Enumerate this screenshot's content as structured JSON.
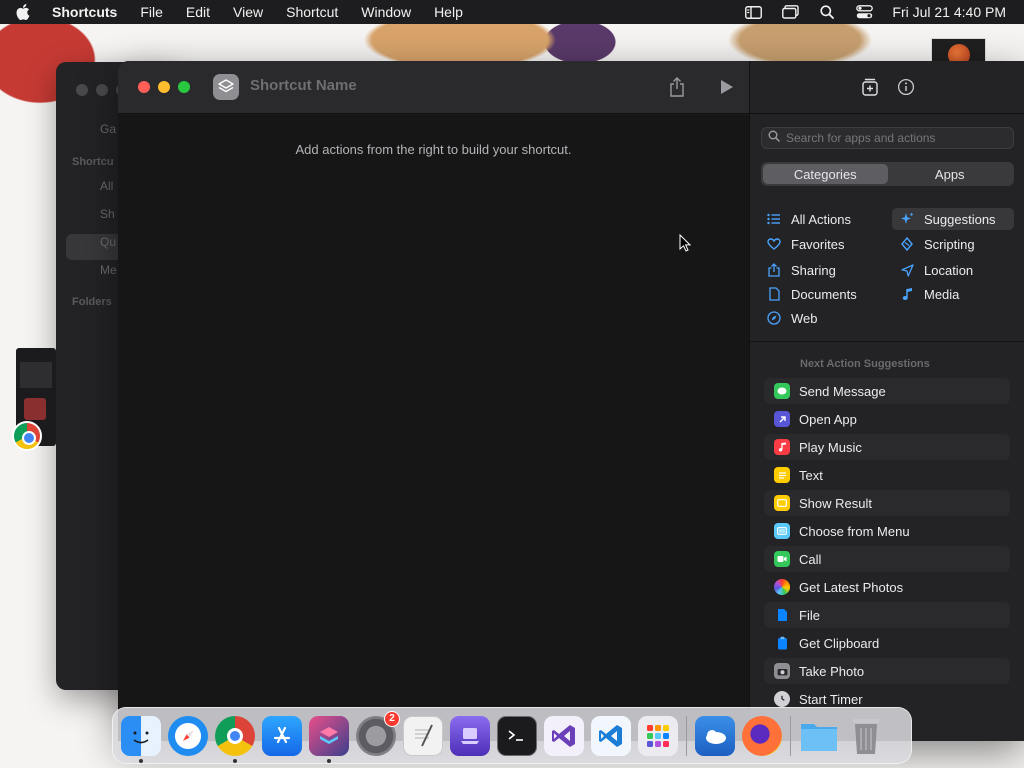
{
  "menubar": {
    "apple_icon": "apple-logo-icon",
    "app_name": "Shortcuts",
    "items": [
      "File",
      "Edit",
      "View",
      "Shortcut",
      "Window",
      "Help"
    ],
    "status_icons": [
      "sidebar-icon",
      "window-switch-icon",
      "search-icon",
      "control-center-icon"
    ],
    "clock": "Fri Jul 21  4:40 PM"
  },
  "library_window": {
    "sidebar_texts": [
      "Ga",
      "Shortcu",
      "All",
      "Sh",
      "Qu",
      "Me",
      "Folders"
    ]
  },
  "editor": {
    "shortcut_name": "Shortcut Name",
    "canvas_hint": "Add actions from the right to build your shortcut.",
    "share_icon": "share-icon",
    "run_icon": "play-icon"
  },
  "panel": {
    "search_placeholder": "Search for apps and actions",
    "segments": [
      "Categories",
      "Apps"
    ],
    "categories": [
      {
        "label": "All Actions",
        "icon": "list-icon",
        "color": "#4aa3ff"
      },
      {
        "label": "Suggestions",
        "icon": "sparkle-icon",
        "color": "#4aa3ff"
      },
      {
        "label": "Favorites",
        "icon": "heart-icon",
        "color": "#4aa3ff"
      },
      {
        "label": "Scripting",
        "icon": "scripting-icon",
        "color": "#4aa3ff"
      },
      {
        "label": "Sharing",
        "icon": "share-icon",
        "color": "#4aa3ff"
      },
      {
        "label": "Location",
        "icon": "location-arrow-icon",
        "color": "#4aa3ff"
      },
      {
        "label": "Documents",
        "icon": "document-icon",
        "color": "#4aa3ff"
      },
      {
        "label": "Media",
        "icon": "music-note-icon",
        "color": "#4aa3ff"
      },
      {
        "label": "Web",
        "icon": "compass-icon",
        "color": "#4aa3ff"
      }
    ],
    "suggestions_title": "Next Action Suggestions",
    "suggestions": [
      {
        "label": "Send Message",
        "icon": "messages-icon",
        "color": "#34c759"
      },
      {
        "label": "Open App",
        "icon": "open-app-icon",
        "color": "#5856d6"
      },
      {
        "label": "Play Music",
        "icon": "music-icon",
        "color": "#fc3c44"
      },
      {
        "label": "Text",
        "icon": "text-icon",
        "color": "#ffcc00"
      },
      {
        "label": "Show Result",
        "icon": "show-result-icon",
        "color": "#ffcc00"
      },
      {
        "label": "Choose from Menu",
        "icon": "menu-icon",
        "color": "#5ac8fa"
      },
      {
        "label": "Call",
        "icon": "phone-icon",
        "color": "#34c759"
      },
      {
        "label": "Get Latest Photos",
        "icon": "photos-icon",
        "color": "#ff9500"
      },
      {
        "label": "File",
        "icon": "file-icon",
        "color": "#0a84ff"
      },
      {
        "label": "Get Clipboard",
        "icon": "clipboard-icon",
        "color": "#0a84ff"
      },
      {
        "label": "Take Photo",
        "icon": "camera-icon",
        "color": "#8e8e93"
      },
      {
        "label": "Start Timer",
        "icon": "timer-icon",
        "color": "#d1d1d6"
      }
    ]
  },
  "dock": {
    "apps": [
      {
        "name": "finder-icon",
        "color": "#2b8ef5",
        "running": true
      },
      {
        "name": "safari-icon",
        "color": "#1f8cf0",
        "running": false
      },
      {
        "name": "chrome-icon",
        "color": "#ffffff",
        "running": true
      },
      {
        "name": "app-store-icon",
        "color": "#1a8cf6",
        "running": false
      },
      {
        "name": "shortcuts-icon",
        "color": "#3c3f8c",
        "running": true
      },
      {
        "name": "system-settings-icon",
        "color": "#7f7f85",
        "running": false,
        "badge": "2"
      },
      {
        "name": "textedit-icon",
        "color": "#f2f2f2",
        "running": false
      },
      {
        "name": "simulator-icon",
        "color": "#6c4ad8",
        "running": false
      },
      {
        "name": "terminal-icon",
        "color": "#1b1b1d",
        "running": false
      },
      {
        "name": "visual-studio-icon",
        "color": "#6b3fb8",
        "running": false
      },
      {
        "name": "vscode-icon",
        "color": "#1b7ed6",
        "running": false
      },
      {
        "name": "launchpad-icon",
        "color": "#e9e9ee",
        "running": false
      }
    ],
    "recent": [
      {
        "name": "weather-icon",
        "color": "#2d7fd8"
      },
      {
        "name": "firefox-icon",
        "color": "#ff7139"
      }
    ],
    "stack": [
      {
        "name": "downloads-folder-icon",
        "color": "#5ab4f2"
      },
      {
        "name": "trash-icon",
        "color": "#9a9aa0"
      }
    ]
  }
}
